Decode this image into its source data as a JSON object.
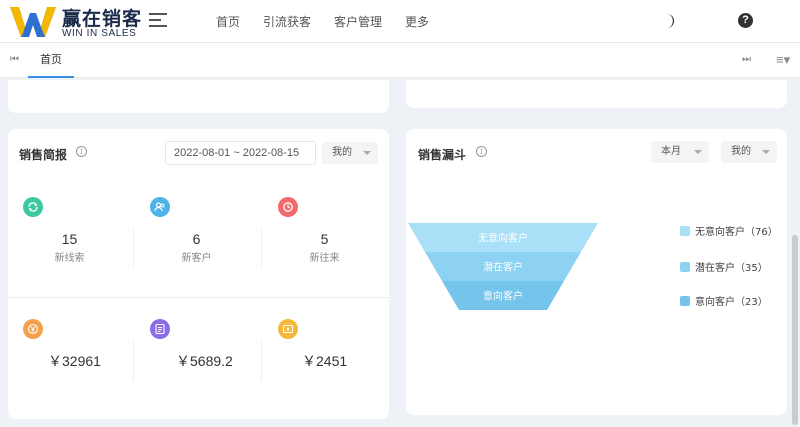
{
  "header": {
    "logo_title": "赢在销客",
    "logo_sub": "WIN IN SALES",
    "nav": [
      "首页",
      "引流获客",
      "客户管理",
      "更多"
    ],
    "help": "?"
  },
  "tabbar": {
    "first_icon": "⏮",
    "home_tab": "首页",
    "last_icon": "⏭",
    "more_icon": "≡▾"
  },
  "sales": {
    "title": "销售简报",
    "info": "i",
    "date_range": "2022-08-01 ~ 2022-08-15",
    "owner_select": "我的",
    "stats": [
      {
        "value": "15",
        "label": "新线索",
        "icon": "refresh-icon",
        "color": "#3ec8a0"
      },
      {
        "value": "6",
        "label": "新客户",
        "icon": "users-icon",
        "color": "#4fb3e8"
      },
      {
        "value": "5",
        "label": "新往来",
        "icon": "timer-icon",
        "color": "#f26a6a"
      }
    ],
    "money": [
      {
        "value": "￥32961",
        "icon": "yen-icon",
        "color": "#f5a04c"
      },
      {
        "value": "￥5689.2",
        "icon": "document-icon",
        "color": "#8a6ee8"
      },
      {
        "value": "￥2451",
        "icon": "wallet-icon",
        "color": "#f5b83c"
      }
    ]
  },
  "funnel": {
    "title": "销售漏斗",
    "info": "i",
    "period_select": "本月",
    "owner_select": "我的",
    "stages": [
      {
        "label": "无意向客户",
        "count": 76,
        "legend": "无意向客户（76）",
        "color": "#a9e0f7"
      },
      {
        "label": "潜在客户",
        "count": 35,
        "legend": "潜在客户（35）",
        "color": "#8dd2f2"
      },
      {
        "label": "意向客户",
        "count": 23,
        "legend": "意向客户（23）",
        "color": "#74c4ec"
      }
    ]
  }
}
